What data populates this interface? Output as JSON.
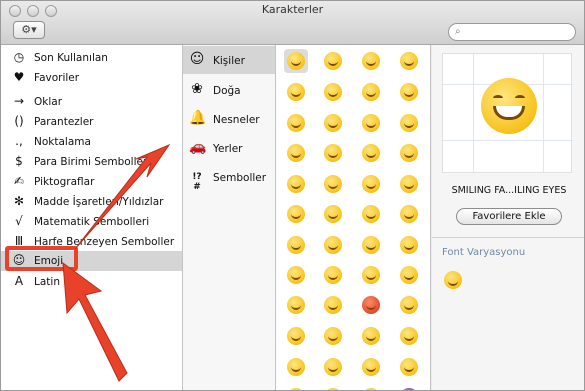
{
  "window": {
    "title": "Karakterler"
  },
  "toolbar": {
    "action_label": "⚙▾",
    "search_placeholder": ""
  },
  "categories": [
    {
      "icon": "◷",
      "label": "Son Kullanılan"
    },
    {
      "icon": "♥",
      "label": "Favoriler"
    },
    {
      "icon": "→",
      "label": "Oklar"
    },
    {
      "icon": "()",
      "label": "Parantezler"
    },
    {
      "icon": ".,",
      "label": "Noktalama"
    },
    {
      "icon": "$",
      "label": "Para Birimi Sembolleri"
    },
    {
      "icon": "✍",
      "label": "Piktograflar"
    },
    {
      "icon": "✻",
      "label": "Madde İşaretleri/Yıldızlar"
    },
    {
      "icon": "√",
      "label": "Matematik Sembolleri"
    },
    {
      "icon": "Ⅲ",
      "label": "Harfe Benzeyen Semboller"
    },
    {
      "icon": "☺",
      "label": "Emoji"
    },
    {
      "icon": "A",
      "label": "Latin"
    }
  ],
  "subcategories": [
    {
      "icon": "☺",
      "label": "Kişiler"
    },
    {
      "icon": "❀",
      "label": "Doğa"
    },
    {
      "icon": "🔔",
      "label": "Nesneler"
    },
    {
      "icon": "🚗",
      "label": "Yerler"
    },
    {
      "icon": "!?#",
      "label": "Semboller"
    }
  ],
  "info": {
    "character_name": "SMILING FA...ILING EYES",
    "favorite_button": "Favorilere Ekle",
    "font_variation_title": "Font Varyasyonu"
  },
  "colors": {
    "highlight": "#e8432a",
    "selection": "#d5d5d5",
    "accent_text": "#6e8aa8"
  }
}
